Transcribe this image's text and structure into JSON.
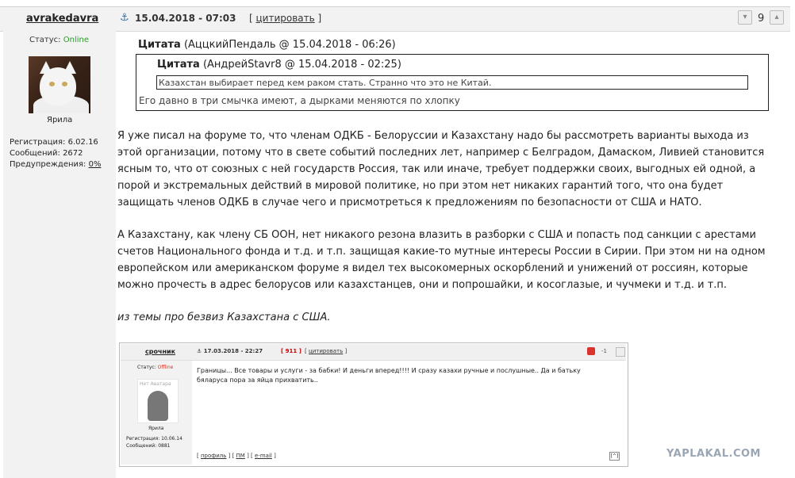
{
  "header": {
    "author": "avrakedavra",
    "date": "15.04.2018 - 07:03",
    "quote_label": "цитировать",
    "rating": "9"
  },
  "profile": {
    "status_label": "Статус:",
    "status_value": "Online",
    "avatar_caption": "Ярила",
    "reg_label": "Регистрация:",
    "reg_value": "6.02.16",
    "msgs_label": "Сообщений:",
    "msgs_value": "2672",
    "warn_label": "Предупреждения:",
    "warn_value": "0%"
  },
  "quote_outer": {
    "label": "Цитата",
    "meta": "(АццкийПендаль @ 15.04.2018 - 06:26)",
    "text": "Его давно в три смычка имеют, а дырками меняются по хлопку"
  },
  "quote_inner": {
    "label": "Цитата",
    "meta": "(АндрейStavr8 @ 15.04.2018 - 02:25)",
    "text": "Казахстан выбирает перед кем раком стать. Странно что это не Китай."
  },
  "body": {
    "p1": "Я уже писал на форуме то, что членам ОДКБ - Белоруссии и Казахстану надо бы рассмотреть варианты выхода из этой организации, потому что в свете событий последних лет, например с Белградом, Дамаском, Ливией становится ясным то, что от союзных с ней государств Россия, так или иначе, требует поддержки своих, выгодных ей одной, а порой и экстремальных действий в мировой политике, но при этом нет никаких гарантий того, что она будет защищать членов ОДКБ в случае чего и присмотреться к предложениям по безопасности от США и НАТО.",
    "p2": "А Казахстану, как члену СБ ООН, нет никакого резона влазить в разборки с США и попасть под санкции с арестами счетов Национального фонда и т.д. и т.п. защищая какие-то мутные интересы России в Сирии. При этом ни на одном европейском или американском форуме я видел тех высокомерных оскорблений и унижений от россиян, которые можно прочесть в адрес белорусов или казахстанцев, они и попрошайки, и косоглазые, и чучмеки и т.д. и т.п.",
    "p3": "из темы про безвиз Казахстана с США."
  },
  "embedded": {
    "author": "срочник",
    "date": "17.03.2018 - 22:27",
    "num": "911",
    "quote_label": "цитировать",
    "rating": "-1",
    "status_label": "Статус:",
    "status_value": "Offline",
    "no_avatar": "Нет Аватара",
    "caption": "Ярила",
    "reg": "Регистрация: 10.06.14",
    "msgs": "Сообщений: 0881",
    "text": "Границы... Все товары и услуги - за бабки! И деньги вперед!!!! И сразу казахи ручные и послушные.. Да и батьку бяларуса пора за яйца прихватить..",
    "f_profile": "профиль",
    "f_pm": "ПМ",
    "f_email": "e-mail",
    "up": "[^]"
  },
  "watermark": "YAPLAKAL.COM"
}
